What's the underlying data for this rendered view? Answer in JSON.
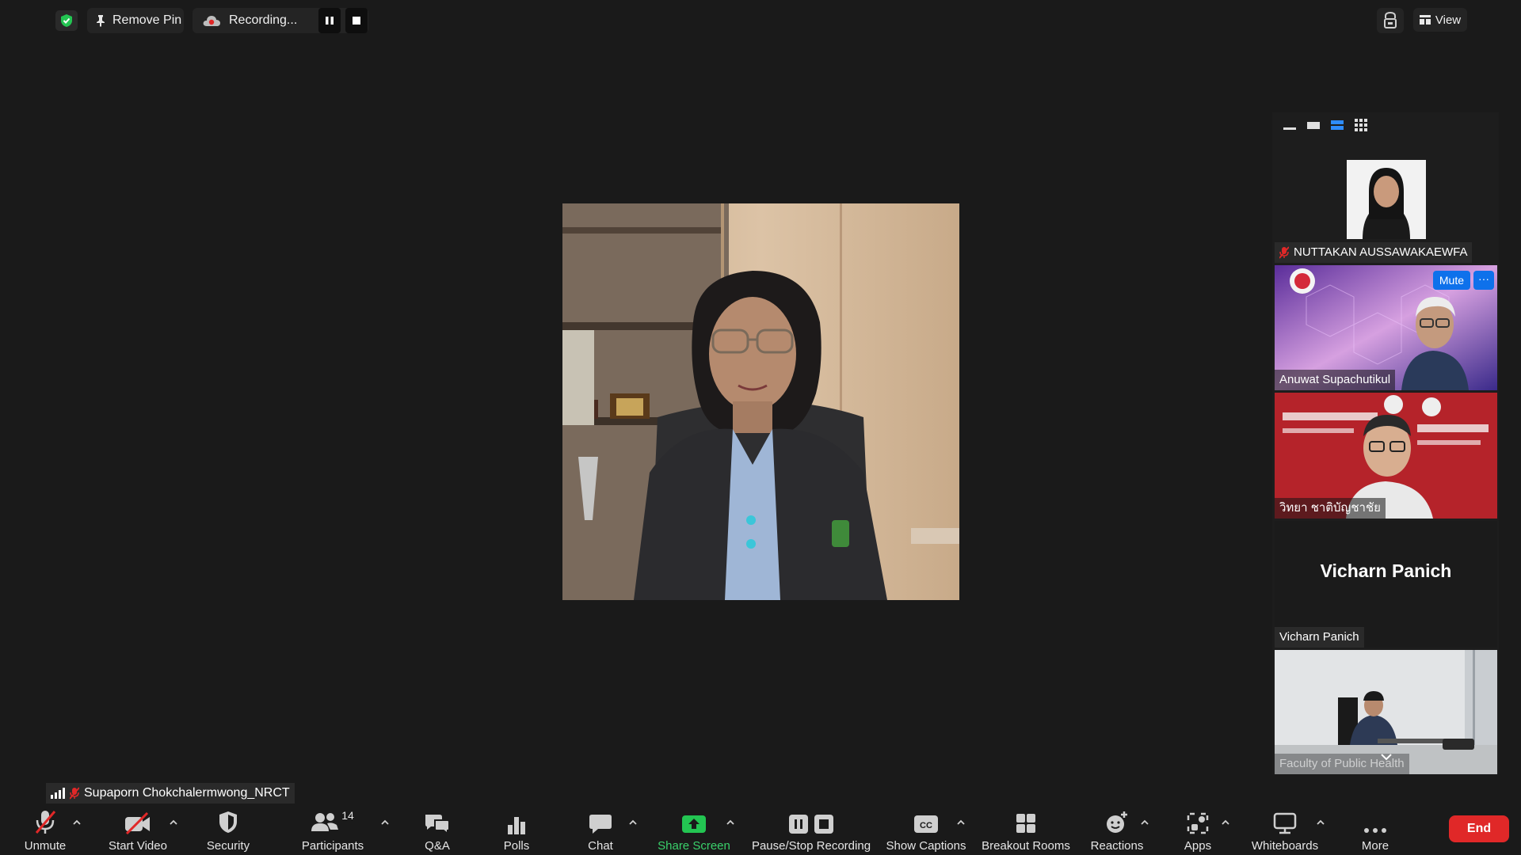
{
  "topbar": {
    "remove_pin": "Remove Pin",
    "recording": "Recording...",
    "view": "View"
  },
  "gallery": {
    "tiles": [
      {
        "name": "NUTTAKAN AUSSAWAKAEWFA",
        "muted": true
      },
      {
        "name": "Anuwat Supachutikul",
        "mute_label": "Mute",
        "more_label": "···"
      },
      {
        "name": "วิทยา ชาติบัญชาชัย"
      },
      {
        "name": "Vicharn Panich",
        "display_name": "Vicharn Panich"
      },
      {
        "name": "Faculty of Public Health"
      }
    ]
  },
  "active_speaker": {
    "name": "Supaporn Chokchalermwong_NRCT",
    "muted": true
  },
  "toolbar": {
    "unmute": "Unmute",
    "start_video": "Start Video",
    "security": "Security",
    "participants": "Participants",
    "participants_count": "14",
    "qa": "Q&A",
    "polls": "Polls",
    "chat": "Chat",
    "share_screen": "Share Screen",
    "pause_stop_recording": "Pause/Stop Recording",
    "show_captions": "Show Captions",
    "breakout_rooms": "Breakout Rooms",
    "reactions": "Reactions",
    "apps": "Apps",
    "whiteboards": "Whiteboards",
    "more": "More",
    "end": "End"
  },
  "colors": {
    "background": "#1a1a1a",
    "accent_blue": "#0e71eb",
    "share_green": "#23c552",
    "end_red": "#e02828",
    "muted_red": "#e02828"
  }
}
